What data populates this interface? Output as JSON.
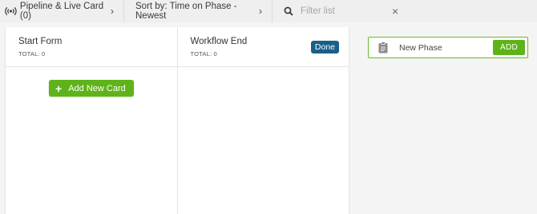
{
  "toolbar": {
    "pipeline_label": "Pipeline & Live Card (0)",
    "sort_label": "Sort by: Time on Phase - Newest",
    "filter_placeholder": "Filter list",
    "chevron": "›",
    "clear": "×"
  },
  "columns": [
    {
      "title": "Start Form",
      "total": "TOTAL: 0",
      "add_card_label": "Add New Card"
    },
    {
      "title": "Workflow End",
      "total": "TOTAL: 0",
      "badge": "Done"
    }
  ],
  "new_phase": {
    "placeholder": "New Phase",
    "add_label": "ADD"
  },
  "colors": {
    "accent_green": "#5fb31a",
    "done_badge": "#1a5f8a"
  },
  "icons": [
    "broadcast-icon",
    "chevron-right-icon",
    "search-icon",
    "close-icon",
    "plus-icon",
    "clipboard-icon"
  ]
}
